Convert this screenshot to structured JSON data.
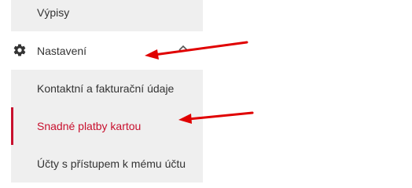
{
  "sidebar": {
    "items": [
      {
        "label": "Výpisy",
        "icon": ""
      },
      {
        "label": "Nastavení",
        "icon": "gear-icon",
        "expanded": true,
        "chevron": "chevron-up-icon"
      }
    ],
    "subitems": [
      {
        "label": "Kontaktní a fakturační údaje",
        "active": false
      },
      {
        "label": "Snadné platby kartou",
        "active": true
      },
      {
        "label": "Účty s přístupem k mému účtu",
        "active": false
      }
    ]
  },
  "annotations": {
    "arrow_color": "#e00000",
    "arrows": [
      "arrow-to-nastaveni",
      "arrow-to-snadne-platby"
    ]
  },
  "colors": {
    "active": "#c8102e",
    "submenu_bg": "#efefef",
    "text": "#333333"
  }
}
